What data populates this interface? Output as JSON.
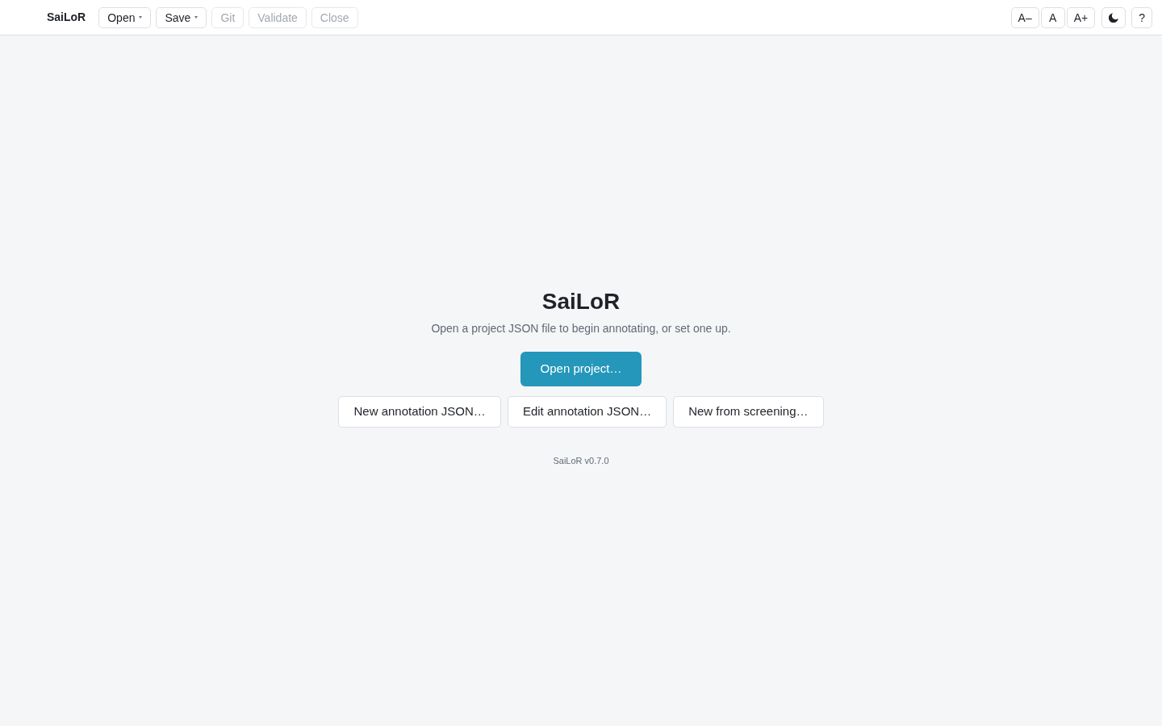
{
  "toolbar": {
    "brand": "SaiLoR",
    "actions": [
      {
        "label": "Open",
        "kind": "dropdown",
        "disabled": false
      },
      {
        "label": "Save",
        "kind": "dropdown",
        "disabled": false
      },
      {
        "label": "Git",
        "kind": "plain",
        "disabled": true
      },
      {
        "label": "Validate",
        "kind": "plain",
        "disabled": true
      },
      {
        "label": "Close",
        "kind": "plain",
        "disabled": true
      }
    ],
    "font_size_buttons": [
      "A–",
      "A",
      "A+"
    ],
    "help_button": "?"
  },
  "welcome": {
    "title": "SaiLoR",
    "subtitle": "Open a project JSON file to begin annotating, or set one up.",
    "primary_button": "Open project…",
    "secondary_buttons": [
      "New annotation JSON…",
      "Edit annotation JSON…",
      "New from screening…"
    ],
    "version": "SaiLoR v0.7.0"
  }
}
